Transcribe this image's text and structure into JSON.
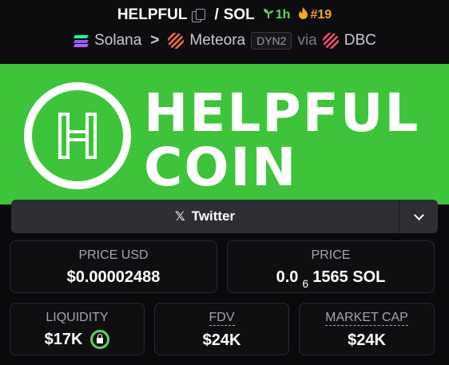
{
  "header": {
    "token_symbol": "HELPFUL",
    "separator": "/",
    "quote_symbol": "SOL",
    "age": "1h",
    "rank": "#19",
    "chain": "Solana",
    "breadcrumb_sep": ">",
    "dex": "Meteora",
    "pool_type": "DYN2",
    "via": "via",
    "launchpad": "DBC"
  },
  "banner": {
    "line1": "HELPFUL",
    "line2": "COIN",
    "background": "#3ec43a"
  },
  "social": {
    "twitter_icon": "x-logo",
    "twitter_label": "Twitter"
  },
  "stats": {
    "price_usd_label": "PRICE USD",
    "price_usd_value": "$0.00002488",
    "price_label": "PRICE",
    "price_prefix": "0.0",
    "price_zeros": "6",
    "price_suffix": "1565 SOL",
    "liquidity_label": "LIQUIDITY",
    "liquidity_value": "$17K",
    "fdv_label": "FDV",
    "fdv_value": "$24K",
    "mcap_label": "MARKET CAP",
    "mcap_value": "$24K"
  },
  "colors": {
    "age_green": "#5fd35f",
    "rank_orange": "#f5a623",
    "lock_green": "#5fd35f"
  }
}
